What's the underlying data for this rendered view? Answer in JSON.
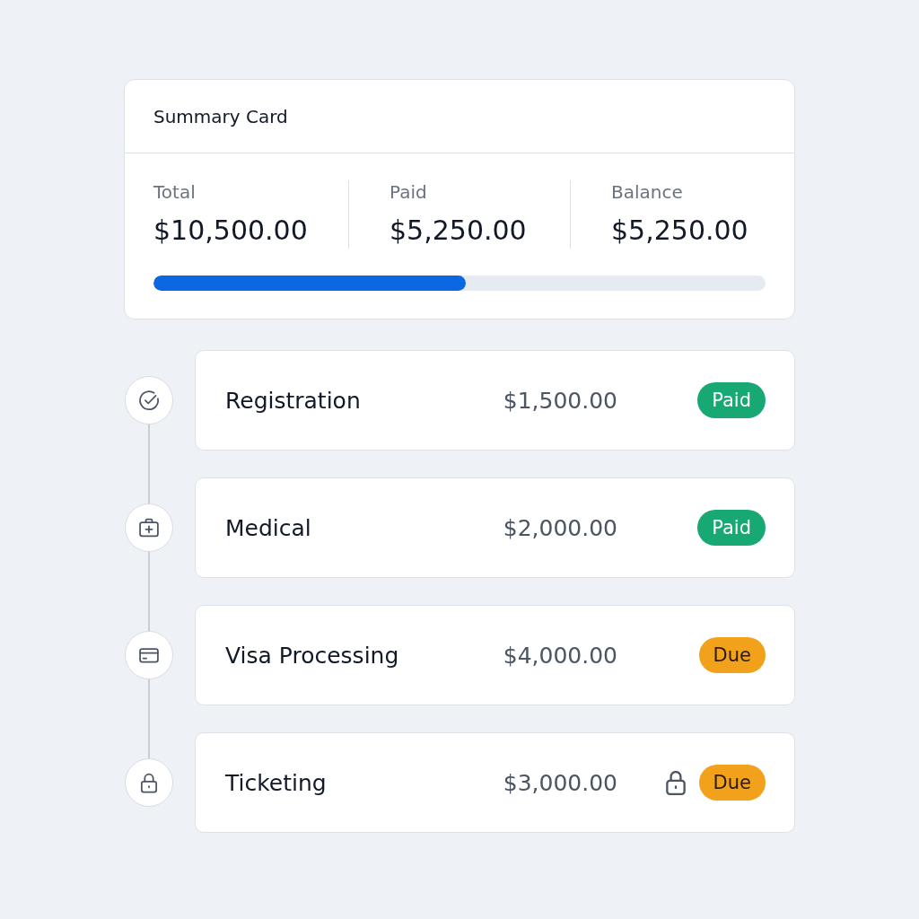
{
  "summary_card": {
    "title": "Summary Card",
    "stats": [
      {
        "label": "Total",
        "value": "$10,500.00"
      },
      {
        "label": "Paid",
        "value": "$5,250.00"
      },
      {
        "label": "Balance",
        "value": "$5,250.00"
      }
    ],
    "progress": {
      "level": 0.51
    }
  },
  "steps": [
    {
      "name": "Registration",
      "amount": "$1,500.00",
      "locked": false,
      "status": {
        "kind": "paid",
        "label": "Paid"
      }
    },
    {
      "name": "Medical",
      "amount": "$2,000.00",
      "locked": false,
      "status": {
        "kind": "paid",
        "label": "Paid"
      }
    },
    {
      "name": "Visa Processing",
      "amount": "$4,000.00",
      "locked": false,
      "status": {
        "kind": "due",
        "label": "Due"
      }
    },
    {
      "name": "Ticketing",
      "amount": "$3,000.00",
      "locked": true,
      "status": {
        "kind": "due",
        "label": "Due"
      }
    }
  ]
}
